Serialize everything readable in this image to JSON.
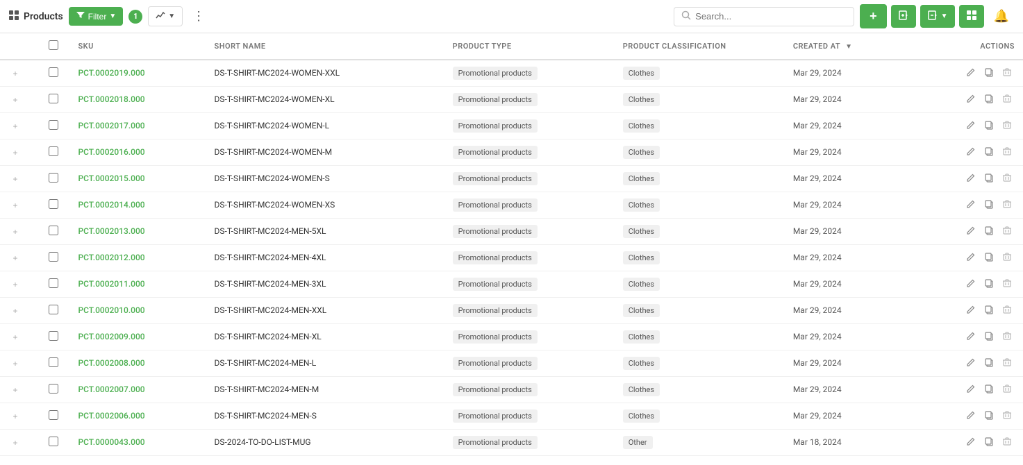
{
  "toolbar": {
    "title": "Products",
    "filter_label": "Filter",
    "filter_count": "1",
    "chart_label": "",
    "more_label": "⋮",
    "search_placeholder": "Search...",
    "add_label": "+",
    "import_label": "Import",
    "export_label": "Export",
    "grid_view_label": "Grid",
    "notification_label": "🔔"
  },
  "table": {
    "columns": {
      "sku": "SKU",
      "short_name": "SHORT NAME",
      "product_type": "PRODUCT TYPE",
      "product_classification": "PRODUCT CLASSIFICATION",
      "created_at": "CREATED AT",
      "actions": "ACTIONS"
    },
    "rows": [
      {
        "sku": "PCT.0002019.000",
        "short_name": "DS-T-SHIRT-MC2024-WOMEN-XXL",
        "product_type": "Promotional products",
        "product_classification": "Clothes",
        "created_at": "Mar 29, 2024"
      },
      {
        "sku": "PCT.0002018.000",
        "short_name": "DS-T-SHIRT-MC2024-WOMEN-XL",
        "product_type": "Promotional products",
        "product_classification": "Clothes",
        "created_at": "Mar 29, 2024"
      },
      {
        "sku": "PCT.0002017.000",
        "short_name": "DS-T-SHIRT-MC2024-WOMEN-L",
        "product_type": "Promotional products",
        "product_classification": "Clothes",
        "created_at": "Mar 29, 2024"
      },
      {
        "sku": "PCT.0002016.000",
        "short_name": "DS-T-SHIRT-MC2024-WOMEN-M",
        "product_type": "Promotional products",
        "product_classification": "Clothes",
        "created_at": "Mar 29, 2024"
      },
      {
        "sku": "PCT.0002015.000",
        "short_name": "DS-T-SHIRT-MC2024-WOMEN-S",
        "product_type": "Promotional products",
        "product_classification": "Clothes",
        "created_at": "Mar 29, 2024"
      },
      {
        "sku": "PCT.0002014.000",
        "short_name": "DS-T-SHIRT-MC2024-WOMEN-XS",
        "product_type": "Promotional products",
        "product_classification": "Clothes",
        "created_at": "Mar 29, 2024"
      },
      {
        "sku": "PCT.0002013.000",
        "short_name": "DS-T-SHIRT-MC2024-MEN-5XL",
        "product_type": "Promotional products",
        "product_classification": "Clothes",
        "created_at": "Mar 29, 2024"
      },
      {
        "sku": "PCT.0002012.000",
        "short_name": "DS-T-SHIRT-MC2024-MEN-4XL",
        "product_type": "Promotional products",
        "product_classification": "Clothes",
        "created_at": "Mar 29, 2024"
      },
      {
        "sku": "PCT.0002011.000",
        "short_name": "DS-T-SHIRT-MC2024-MEN-3XL",
        "product_type": "Promotional products",
        "product_classification": "Clothes",
        "created_at": "Mar 29, 2024"
      },
      {
        "sku": "PCT.0002010.000",
        "short_name": "DS-T-SHIRT-MC2024-MEN-XXL",
        "product_type": "Promotional products",
        "product_classification": "Clothes",
        "created_at": "Mar 29, 2024"
      },
      {
        "sku": "PCT.0002009.000",
        "short_name": "DS-T-SHIRT-MC2024-MEN-XL",
        "product_type": "Promotional products",
        "product_classification": "Clothes",
        "created_at": "Mar 29, 2024"
      },
      {
        "sku": "PCT.0002008.000",
        "short_name": "DS-T-SHIRT-MC2024-MEN-L",
        "product_type": "Promotional products",
        "product_classification": "Clothes",
        "created_at": "Mar 29, 2024"
      },
      {
        "sku": "PCT.0002007.000",
        "short_name": "DS-T-SHIRT-MC2024-MEN-M",
        "product_type": "Promotional products",
        "product_classification": "Clothes",
        "created_at": "Mar 29, 2024"
      },
      {
        "sku": "PCT.0002006.000",
        "short_name": "DS-T-SHIRT-MC2024-MEN-S",
        "product_type": "Promotional products",
        "product_classification": "Clothes",
        "created_at": "Mar 29, 2024"
      },
      {
        "sku": "PCT.0000043.000",
        "short_name": "DS-2024-TO-DO-LIST-MUG",
        "product_type": "Promotional products",
        "product_classification": "Other",
        "created_at": "Mar 18, 2024"
      }
    ]
  }
}
